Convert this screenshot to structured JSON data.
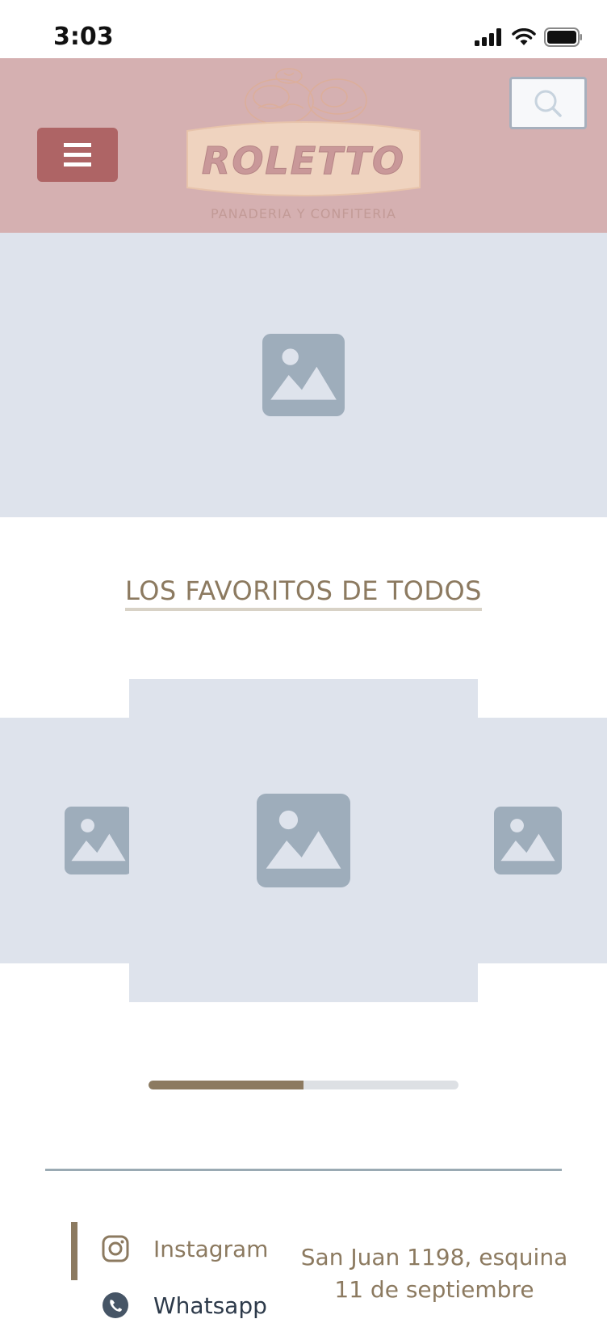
{
  "status_bar": {
    "time": "3:03",
    "icons": [
      "signal-icon",
      "wifi-icon",
      "battery-icon"
    ]
  },
  "header": {
    "brand": "ROLETTO",
    "tagline": "PANADERIA Y CONFITERIA",
    "menu_icon": "hamburger-icon",
    "search_icon": "search-icon"
  },
  "hero": {
    "image_icon": "image-placeholder-icon"
  },
  "favorites": {
    "title": "LOS FAVORITOS DE TODOS",
    "slides": [
      "image-placeholder-icon",
      "image-placeholder-icon",
      "image-placeholder-icon"
    ],
    "progress": 0.5
  },
  "footer": {
    "social": [
      {
        "icon": "instagram-icon",
        "label": "Instagram"
      },
      {
        "icon": "whatsapp-icon",
        "label": "Whatsapp"
      }
    ],
    "address_line1": "San Juan 1198, esquina",
    "address_line2": "11 de septiembre"
  },
  "colors": {
    "header_bg": "#d5b0b1",
    "menu_button": "#ae6465",
    "placeholder_bg": "#dee3ec",
    "placeholder_icon": "#9eadbb",
    "accent_text": "#8c7a60",
    "logo_banner": "#efd3bf"
  }
}
